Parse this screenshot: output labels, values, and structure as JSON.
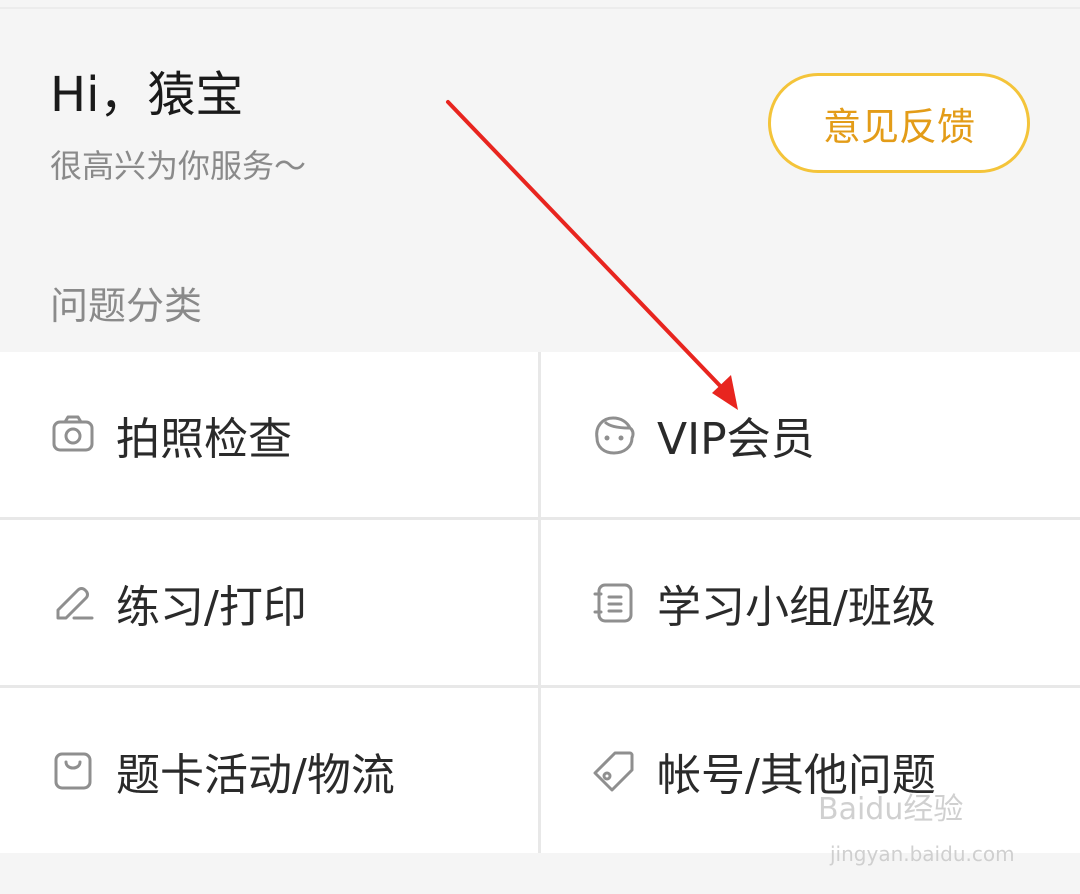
{
  "header": {
    "greeting": "Hi，猿宝",
    "subgreeting": "很高兴为你服务～",
    "feedback_label": "意见反馈"
  },
  "section_title": "问题分类",
  "categories": [
    {
      "label": "拍照检查",
      "icon": "camera-icon"
    },
    {
      "label": "VIP会员",
      "icon": "face-icon"
    },
    {
      "label": "练习/打印",
      "icon": "pencil-icon"
    },
    {
      "label": "学习小组/班级",
      "icon": "notebook-icon"
    },
    {
      "label": "题卡活动/物流",
      "icon": "bag-icon"
    },
    {
      "label": "帐号/其他问题",
      "icon": "tag-icon"
    }
  ],
  "annotation": {
    "color": "#e8251f"
  },
  "watermark": {
    "text": "Baidu经验",
    "url": "jingyan.baidu.com"
  }
}
